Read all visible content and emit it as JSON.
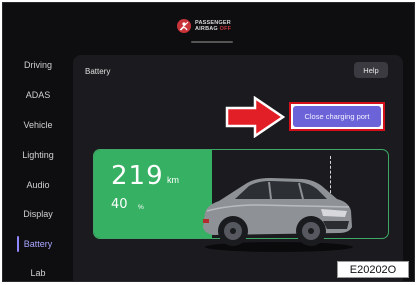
{
  "status": {
    "airbag_line1": "PASSENGER",
    "airbag_line2": "AIRBAG",
    "airbag_state": "OFF"
  },
  "sidebar": {
    "items": [
      {
        "label": "Driving"
      },
      {
        "label": "ADAS"
      },
      {
        "label": "Vehicle"
      },
      {
        "label": "Lighting"
      },
      {
        "label": "Audio"
      },
      {
        "label": "Display"
      },
      {
        "label": "Battery"
      },
      {
        "label": "Lab"
      }
    ],
    "active_index": 6
  },
  "battery_panel": {
    "title": "Battery",
    "help_label": "Help",
    "close_port_label": "Close charging port",
    "range_value": "219",
    "range_unit": "km",
    "percent_value": "40",
    "percent_unit": "%",
    "charge_level_fraction": 0.4
  },
  "figure_code": "E20202O",
  "colors": {
    "accent": "#6d63d8",
    "battery_green": "#36b062",
    "highlight_red": "#d4101a",
    "active_nav": "#a9a6ff"
  }
}
